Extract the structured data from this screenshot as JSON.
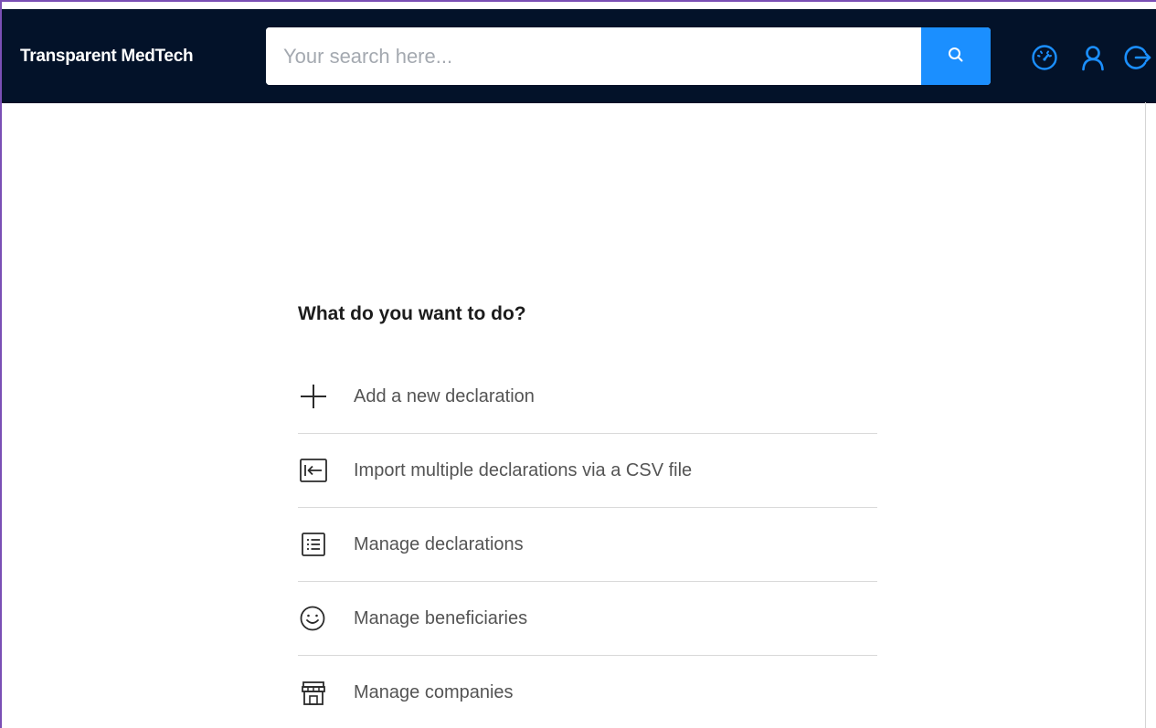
{
  "header": {
    "brand": "Transparent MedTech",
    "search": {
      "placeholder": "Your search here...",
      "value": ""
    },
    "icons": [
      "dashboard-gauge-icon",
      "user-icon",
      "logout-icon"
    ],
    "background_color": "#031229",
    "accent_color": "#1b8fff"
  },
  "main": {
    "heading": "What do you want to do?",
    "actions": [
      {
        "label": "Add a new declaration",
        "icon": "plus-icon"
      },
      {
        "label": "Import multiple declarations via a CSV file",
        "icon": "import-icon"
      },
      {
        "label": "Manage declarations",
        "icon": "list-icon"
      },
      {
        "label": "Manage beneficiaries",
        "icon": "smiley-icon"
      },
      {
        "label": "Manage companies",
        "icon": "store-icon"
      }
    ]
  }
}
